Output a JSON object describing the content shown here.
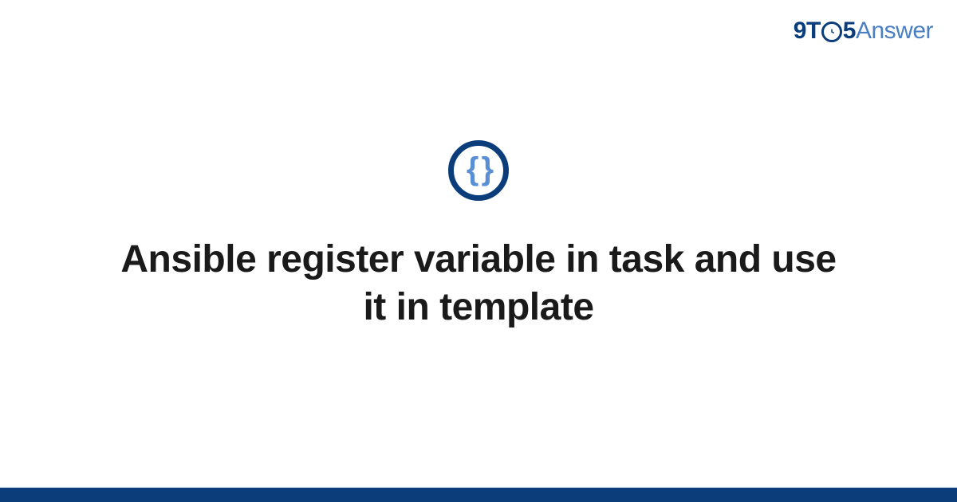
{
  "logo": {
    "part1": "9",
    "part2": "T",
    "part3": "5",
    "part4": "Answer"
  },
  "icon": {
    "name": "code-braces-icon",
    "glyph": "{ }"
  },
  "title": "Ansible register variable in task and use it in template",
  "colors": {
    "primary": "#0a3d7a",
    "secondary": "#4a7fc4",
    "iconBrace": "#5b8fd4"
  }
}
